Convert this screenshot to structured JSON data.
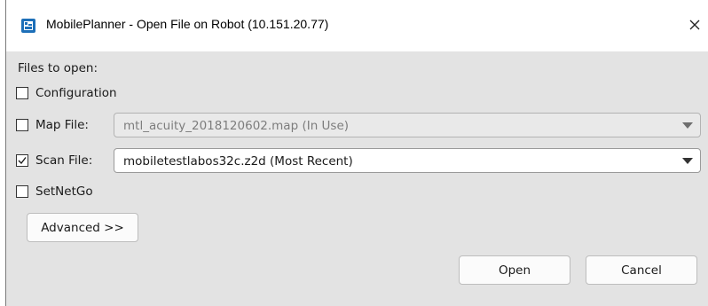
{
  "window": {
    "title": "MobilePlanner - Open File on Robot (10.151.20.77)",
    "close_glyph": "✕",
    "app_icon": "mobileplanner-app-icon"
  },
  "form": {
    "files_label": "Files to open:",
    "configuration": {
      "label": "Configuration",
      "checked": false
    },
    "map_file": {
      "label": "Map File:",
      "checked": false,
      "value": "mtl_acuity_2018120602.map  (In Use)",
      "enabled": false
    },
    "scan_file": {
      "label": "Scan File:",
      "checked": true,
      "value": "mobiletestlabos32c.z2d  (Most Recent)",
      "enabled": true
    },
    "setnetgo": {
      "label": "SetNetGo",
      "checked": false
    },
    "advanced_label": "Advanced >>"
  },
  "footer": {
    "open_label": "Open",
    "cancel_label": "Cancel"
  },
  "colors": {
    "client_bg": "#e3e3e3",
    "icon_blue": "#1d6fb8"
  }
}
